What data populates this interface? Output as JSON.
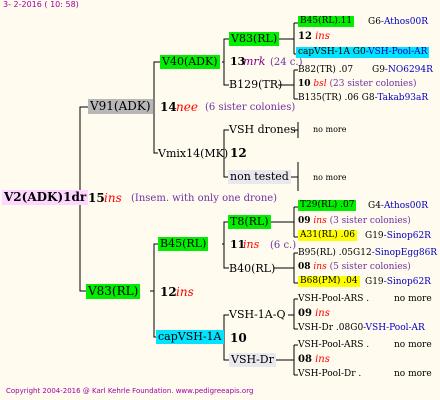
{
  "header": "3- 2-2016 ( 10: 58)",
  "footer": "Copyright 2004-2016 @ Karl Kehrle Foundation.   www.pedigreeapis.org",
  "root": {
    "label": "V2(ADK)1dr",
    "num": "15",
    "ins": "ins",
    "note": "(Insem. with only one drone)"
  },
  "v91": {
    "label": "V91(ADK)",
    "num": "14",
    "ins": "nee",
    "note": "(6 sister colonies)"
  },
  "v40": {
    "label": "V40(ADK)",
    "num": "13",
    "ins": "mrk",
    "note": "(24 c.)"
  },
  "v83top": {
    "label": "V83(RL)"
  },
  "b129": {
    "label": "B129(TR)"
  },
  "b45_top": {
    "label": "B45(RL)",
    "num": ".11",
    "tag": "G6",
    "dest": "-Athos00R"
  },
  "top12": {
    "num": "12",
    "ins": "ins"
  },
  "capvsh_top": {
    "label": "capVSH-1A G0",
    "dest": "-VSH-Pool-AR"
  },
  "b82": {
    "label": "B82(TR)",
    "num": ".07",
    "tag": "G9",
    "dest": "-NO6294R"
  },
  "top10": {
    "num": "10",
    "ins": "bsl",
    "note": "(23 sister colonies)"
  },
  "b135": {
    "label": "B135(TR)",
    "num": ".06",
    "tag": "G8",
    "dest": "-Takab93aR"
  },
  "vmix": {
    "label": "Vmix14(MK)",
    "num": "12"
  },
  "vshdrones": {
    "label": "VSH drones",
    "more": "no more"
  },
  "nontested": {
    "label": "non tested",
    "more": "no more"
  },
  "v83": {
    "label": "V83(RL)",
    "num": "12",
    "ins": "ins"
  },
  "b45": {
    "label": "B45(RL)",
    "num": "11",
    "ins": "ins",
    "note": "(6 c.)"
  },
  "t8": {
    "label": "T8(RL)"
  },
  "b40": {
    "label": "B40(RL)"
  },
  "t29": {
    "label": "T29(RL)",
    "num": ".07",
    "tag": "G4",
    "dest": "-Athos00R"
  },
  "r09a": {
    "num": "09",
    "ins": "ins",
    "note": "(3 sister colonies)"
  },
  "a31": {
    "label": "A31(RL)",
    "num": ".06",
    "tag": "G19",
    "dest": "-Sinop62R"
  },
  "b95": {
    "label": "B95(RL)",
    "num": ".05",
    "tag": "G12",
    "dest": "-SinopEgg86R"
  },
  "r08a": {
    "num": "08",
    "ins": "ins",
    "note": "(5 sister colonies)"
  },
  "b68": {
    "label": "B68(PM)",
    "num": ".04",
    "tag": "G19",
    "dest": "-Sinop62R"
  },
  "capvsh": {
    "label": "capVSH-1A",
    "num": "10"
  },
  "vsh1aq": {
    "label": "VSH-1A-Q"
  },
  "vshdr": {
    "label": "VSH-Dr"
  },
  "pool_ars1": {
    "label": "VSH-Pool-ARS .",
    "more": "no more"
  },
  "r09b": {
    "num": "09",
    "ins": "ins"
  },
  "vshdr_g0": {
    "label": "VSH-Dr .08",
    "tag": "G0",
    "dest": "-VSH-Pool-AR"
  },
  "pool_ars2": {
    "label": "VSH-Pool-ARS .",
    "more": "no more"
  },
  "r08b": {
    "num": "08",
    "ins": "ins"
  },
  "pooldr": {
    "label": "VSH-Pool-Dr .",
    "more": "no more"
  }
}
